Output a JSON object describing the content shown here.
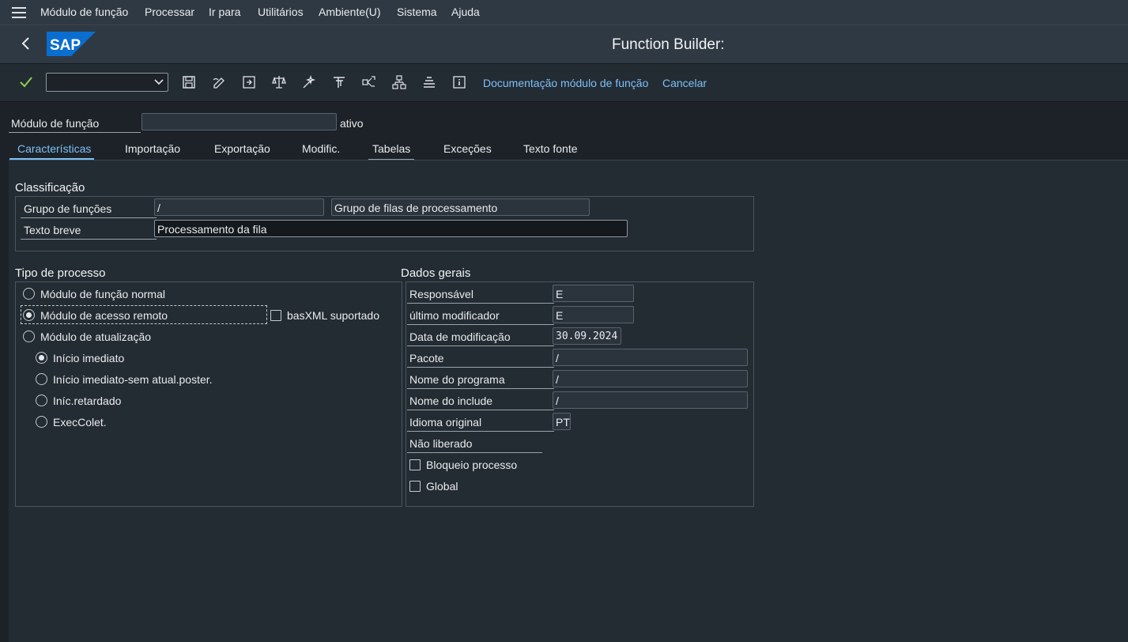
{
  "menubar": {
    "items": [
      "Módulo de função",
      "Processar",
      "Ir para",
      "Utilitários",
      "Ambiente(U)",
      "Sistema",
      "Ajuda"
    ]
  },
  "titlebar": {
    "title": "Function Builder:",
    "logo_text": "SAP"
  },
  "toolbar": {
    "command_value": "",
    "doc_link": "Documentação módulo de função",
    "cancel_link": "Cancelar",
    "icons": [
      "check-icon",
      "save-icon",
      "edit-icon",
      "display-object-list-icon",
      "check-object-icon",
      "activate-icon",
      "test-icon",
      "where-used-icon",
      "hierarchy-icon",
      "pattern-icon",
      "info-icon"
    ]
  },
  "header": {
    "label": "Módulo de função",
    "value": "",
    "status": "ativo"
  },
  "tabs": [
    "Características",
    "Importação",
    "Exportação",
    "Modific.",
    "Tabelas",
    "Exceções",
    "Texto fonte"
  ],
  "classification": {
    "title": "Classificação",
    "group_label": "Grupo de funções",
    "group_value": "/",
    "group_desc": "Grupo de filas de processamento",
    "short_text_label": "Texto breve",
    "short_text_value": "Processamento da fila"
  },
  "process_type": {
    "title": "Tipo de processo",
    "options": [
      "Módulo de função normal",
      "Módulo de acesso remoto",
      "Módulo de atualização"
    ],
    "selected": 1,
    "basxml_label": "basXML suportado",
    "basxml_checked": false,
    "update_options": [
      "Início imediato",
      "Início imediato-sem atual.poster.",
      "Iníc.retardado",
      "ExecColet."
    ],
    "update_selected": 0
  },
  "general_data": {
    "title": "Dados gerais",
    "responsible_label": "Responsável",
    "responsible_value": "E",
    "last_modifier_label": "último modificador",
    "last_modifier_value": "E",
    "mod_date_label": "Data de modificação",
    "mod_date_value": "30.09.2024",
    "package_label": "Pacote",
    "package_value": "/",
    "program_label": "Nome do programa",
    "program_value": "/",
    "include_label": "Nome do include",
    "include_value": "/",
    "language_label": "Idioma original",
    "language_value": "PT",
    "not_released_label": "Não liberado",
    "lock_process_label": "Bloqueio processo",
    "global_label": "Global"
  },
  "colors": {
    "accent": "#7ec0f7",
    "brand": "#0a6ed1"
  }
}
